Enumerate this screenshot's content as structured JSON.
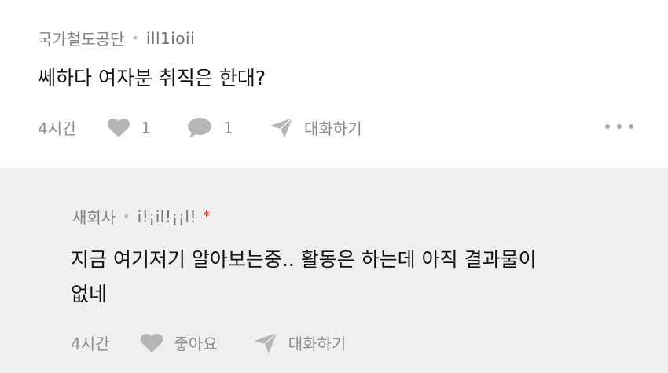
{
  "comment": {
    "category": "국가철도공단",
    "separator": "•",
    "author": "ill1ioii",
    "text": "쎄하다 여자분 취직은 한대?",
    "time": "4시간",
    "like_count": "1",
    "reply_count": "1",
    "chat_label": "대화하기"
  },
  "reply": {
    "category": "새회사",
    "separator": "•",
    "author": "i!¡il!¡¡l!",
    "author_mark": "*",
    "text": "지금 여기저기 알아보는중.. 활동은 하는데 아직 결과물이\n없네",
    "time": "4시간",
    "like_label": "좋아요",
    "chat_label": "대화하기"
  },
  "colors": {
    "reply_background": "#efefef",
    "icon_gray": "#b5b5b5",
    "author_mark": "#e0332a"
  },
  "icons": [
    "heart-icon",
    "speech-bubble-icon",
    "send-arrow-icon",
    "more-dots-icon"
  ]
}
